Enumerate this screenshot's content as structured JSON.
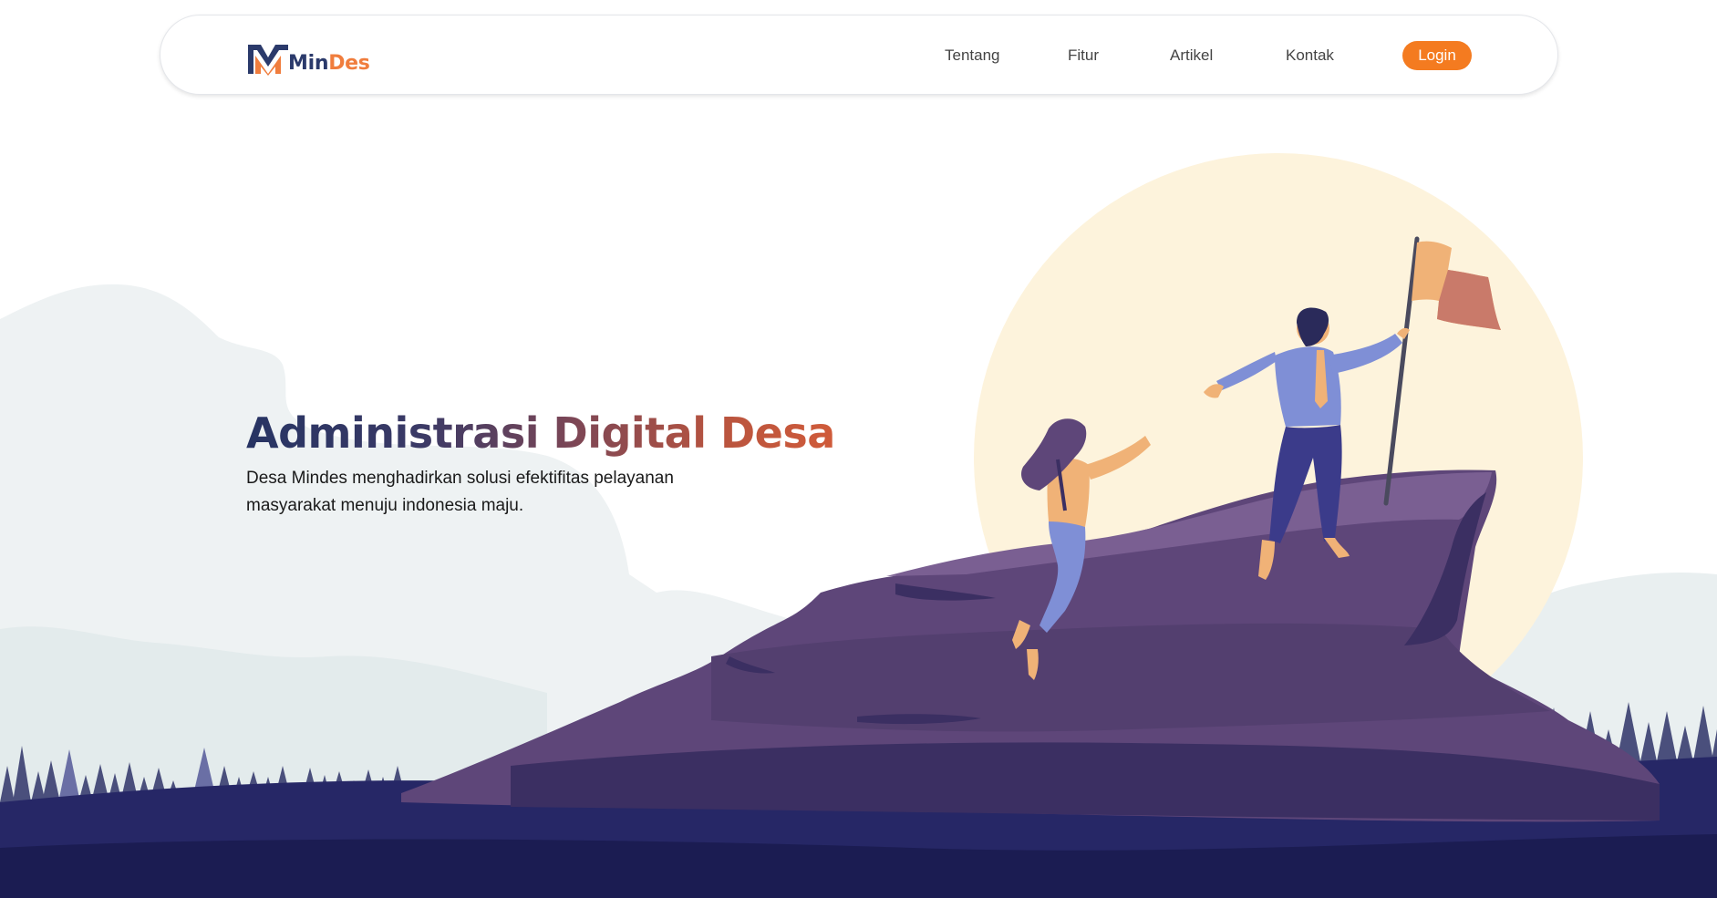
{
  "navbar": {
    "logo": {
      "text_min": "Min",
      "text_des": "Des",
      "icon": "mindes-m-logo-icon"
    },
    "links": [
      {
        "label": "Tentang"
      },
      {
        "label": "Fitur"
      },
      {
        "label": "Artikel"
      },
      {
        "label": "Kontak"
      }
    ],
    "login_label": "Login"
  },
  "hero": {
    "title_part1": "Administrasi",
    "title_part2": "Digital Desa",
    "description": "Desa Mindes menghadirkan solusi efektifitas pelayanan masyarakat menuju indonesia maju.",
    "illustration": "mountain-summit-flag-illustration"
  },
  "colors": {
    "brand_navy": "#2b3a6b",
    "brand_orange": "#f07d3d",
    "login_button": "#f47b20",
    "sun": "#fdf3dc",
    "rock": "#6a4e7e",
    "ground": "#1e1f55"
  }
}
